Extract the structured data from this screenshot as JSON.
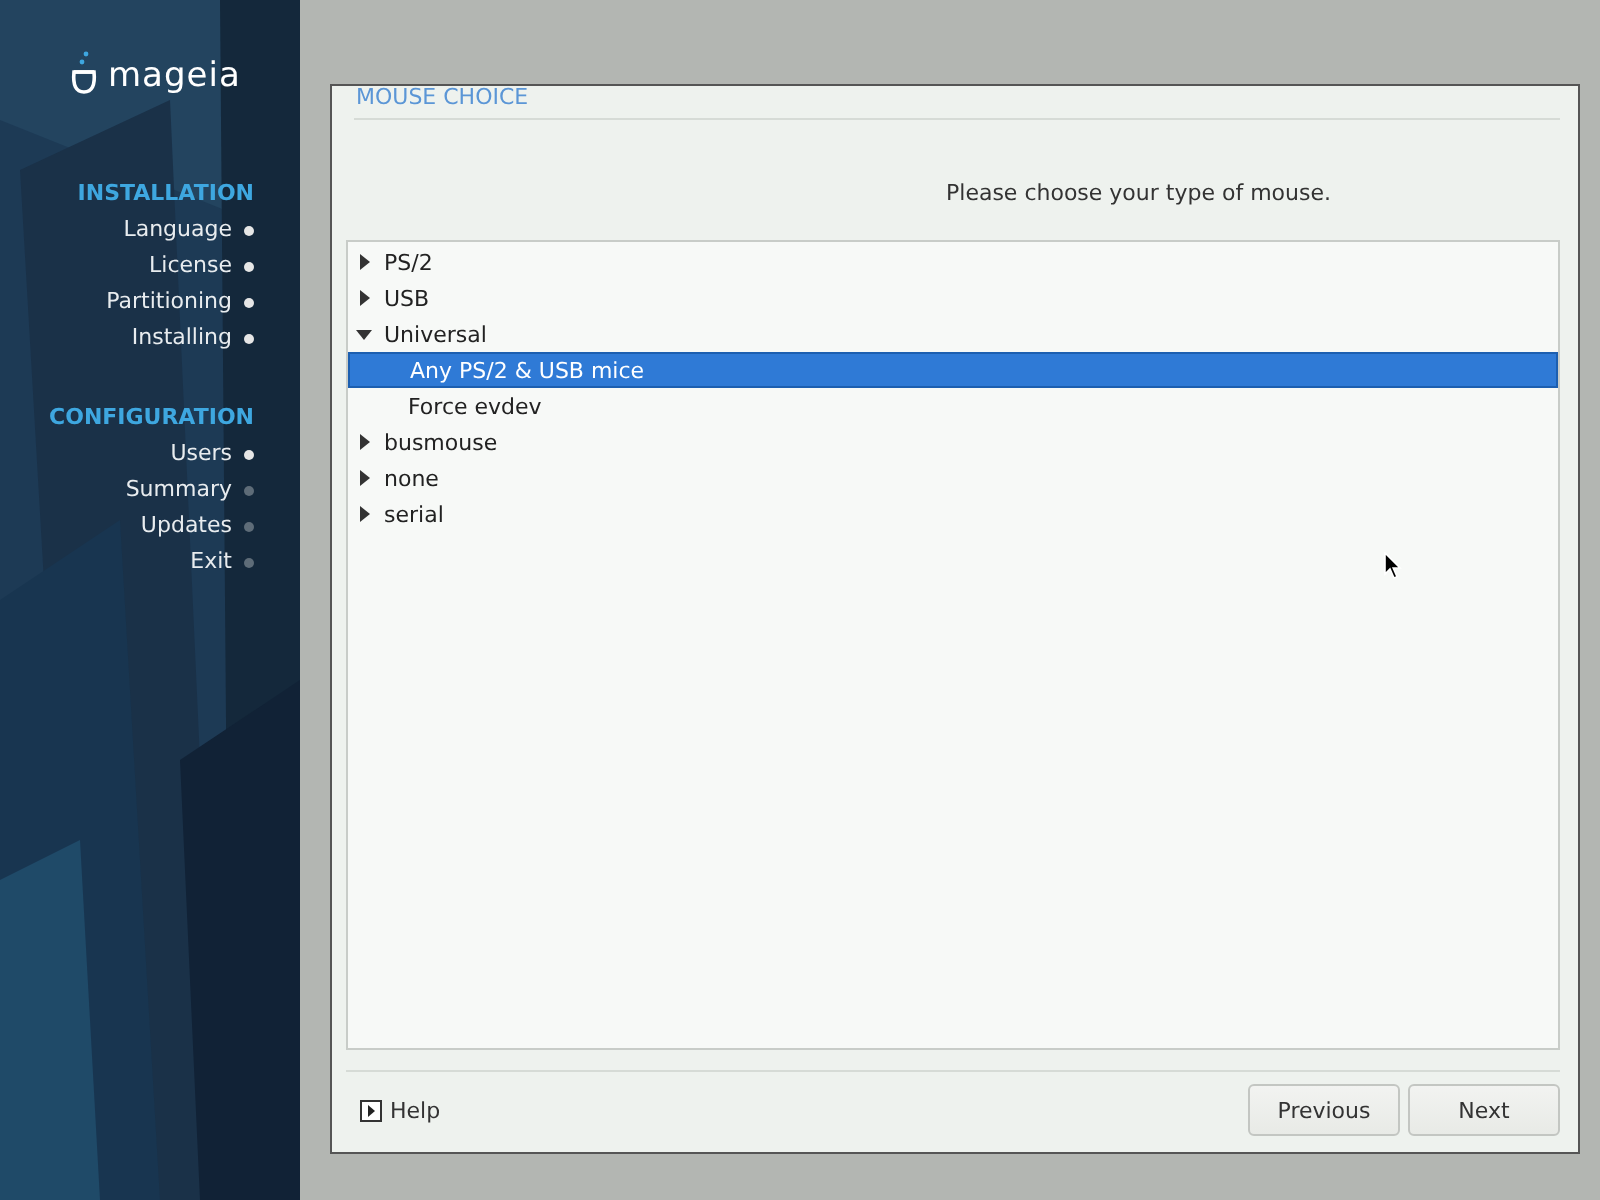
{
  "sidebar": {
    "logo": "mageia",
    "sections": [
      {
        "title": "INSTALLATION",
        "steps": [
          {
            "label": "Language",
            "done": true
          },
          {
            "label": "License",
            "done": true
          },
          {
            "label": "Partitioning",
            "done": true
          },
          {
            "label": "Installing",
            "done": true
          }
        ]
      },
      {
        "title": "CONFIGURATION",
        "steps": [
          {
            "label": "Users",
            "done": true
          },
          {
            "label": "Summary",
            "done": false
          },
          {
            "label": "Updates",
            "done": false
          },
          {
            "label": "Exit",
            "done": false
          }
        ]
      }
    ]
  },
  "dialog": {
    "title": "MOUSE CHOICE",
    "prompt": "Please choose your type of mouse.",
    "tree": [
      {
        "label": "PS/2",
        "expanded": false,
        "selected": false
      },
      {
        "label": "USB",
        "expanded": false,
        "selected": false
      },
      {
        "label": "Universal",
        "expanded": true,
        "selected": false,
        "children": [
          {
            "label": "Any PS/2 & USB mice",
            "selected": true
          },
          {
            "label": "Force evdev",
            "selected": false
          }
        ]
      },
      {
        "label": "busmouse",
        "expanded": false,
        "selected": false
      },
      {
        "label": "none",
        "expanded": false,
        "selected": false
      },
      {
        "label": "serial",
        "expanded": false,
        "selected": false
      }
    ],
    "help": "Help",
    "buttons": [
      "Previous",
      "Next"
    ]
  }
}
